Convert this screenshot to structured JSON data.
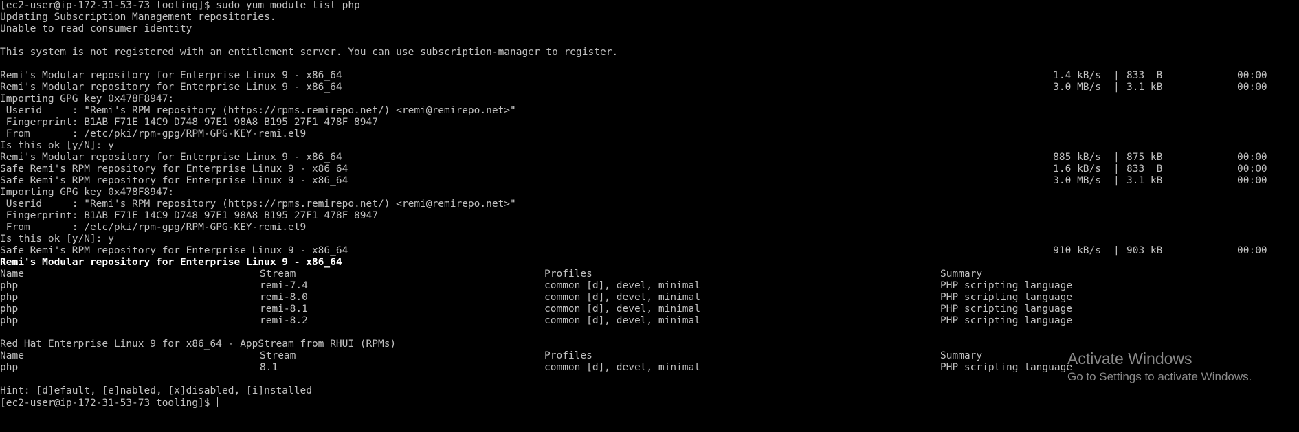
{
  "terminal": {
    "line1": "[ec2-user@ip-172-31-53-73 tooling]$ sudo yum module list php",
    "line2": "Updating Subscription Management repositories.",
    "line3": "Unable to read consumer identity",
    "line4": "This system is not registered with an entitlement server. You can use subscription-manager to register.",
    "downloads": [
      {
        "repo": "Remi's Modular repository for Enterprise Linux 9 - x86_64",
        "rate": "1.4 kB/s",
        "size": "833  B",
        "time": "00:00"
      },
      {
        "repo": "Remi's Modular repository for Enterprise Linux 9 - x86_64",
        "rate": "3.0 MB/s",
        "size": "3.1 kB",
        "time": "00:00"
      },
      {
        "repo": "Remi's Modular repository for Enterprise Linux 9 - x86_64",
        "rate": "885 kB/s",
        "size": "875 kB",
        "time": "00:00"
      },
      {
        "repo": "Safe Remi's RPM repository for Enterprise Linux 9 - x86_64",
        "rate": "1.6 kB/s",
        "size": "833  B",
        "time": "00:00"
      },
      {
        "repo": "Safe Remi's RPM repository for Enterprise Linux 9 - x86_64",
        "rate": "3.0 MB/s",
        "size": "3.1 kB",
        "time": "00:00"
      },
      {
        "repo": "Safe Remi's RPM repository for Enterprise Linux 9 - x86_64",
        "rate": "910 kB/s",
        "size": "903 kB",
        "time": "00:00"
      }
    ],
    "sep": "|",
    "gpg1": {
      "importing": "Importing GPG key 0x478F8947:",
      "userid": " Userid     : \"Remi's RPM repository (https://rpms.remirepo.net/) <remi@remirepo.net>\"",
      "fingerprint": " Fingerprint: B1AB F71E 14C9 D748 97E1 98A8 B195 27F1 478F 8947",
      "from": " From       : /etc/pki/rpm-gpg/RPM-GPG-KEY-remi.el9",
      "prompt": "Is this ok [y/N]: y"
    },
    "gpg2": {
      "importing": "Importing GPG key 0x478F8947:",
      "userid": " Userid     : \"Remi's RPM repository (https://rpms.remirepo.net/) <remi@remirepo.net>\"",
      "fingerprint": " Fingerprint: B1AB F71E 14C9 D748 97E1 98A8 B195 27F1 478F 8947",
      "from": " From       : /etc/pki/rpm-gpg/RPM-GPG-KEY-remi.el9",
      "prompt": "Is this ok [y/N]: y"
    },
    "section1": {
      "title": "Remi's Modular repository for Enterprise Linux 9 - x86_64",
      "headers": [
        "Name",
        "Stream",
        "Profiles",
        "Summary"
      ],
      "rows": [
        [
          "php",
          "remi-7.4",
          "common [d], devel, minimal",
          "PHP scripting language"
        ],
        [
          "php",
          "remi-8.0",
          "common [d], devel, minimal",
          "PHP scripting language"
        ],
        [
          "php",
          "remi-8.1",
          "common [d], devel, minimal",
          "PHP scripting language"
        ],
        [
          "php",
          "remi-8.2",
          "common [d], devel, minimal",
          "PHP scripting language"
        ]
      ]
    },
    "section2": {
      "title": "Red Hat Enterprise Linux 9 for x86_64 - AppStream from RHUI (RPMs)",
      "headers": [
        "Name",
        "Stream",
        "Profiles",
        "Summary"
      ],
      "rows": [
        [
          "php",
          "8.1",
          "common [d], devel, minimal",
          "PHP scripting language"
        ]
      ]
    },
    "hint": "Hint: [d]efault, [e]nabled, [x]disabled, [i]nstalled",
    "final_prompt": "[ec2-user@ip-172-31-53-73 tooling]$ "
  },
  "watermark": {
    "title": "Activate Windows",
    "subtitle": "Go to Settings to activate Windows."
  }
}
